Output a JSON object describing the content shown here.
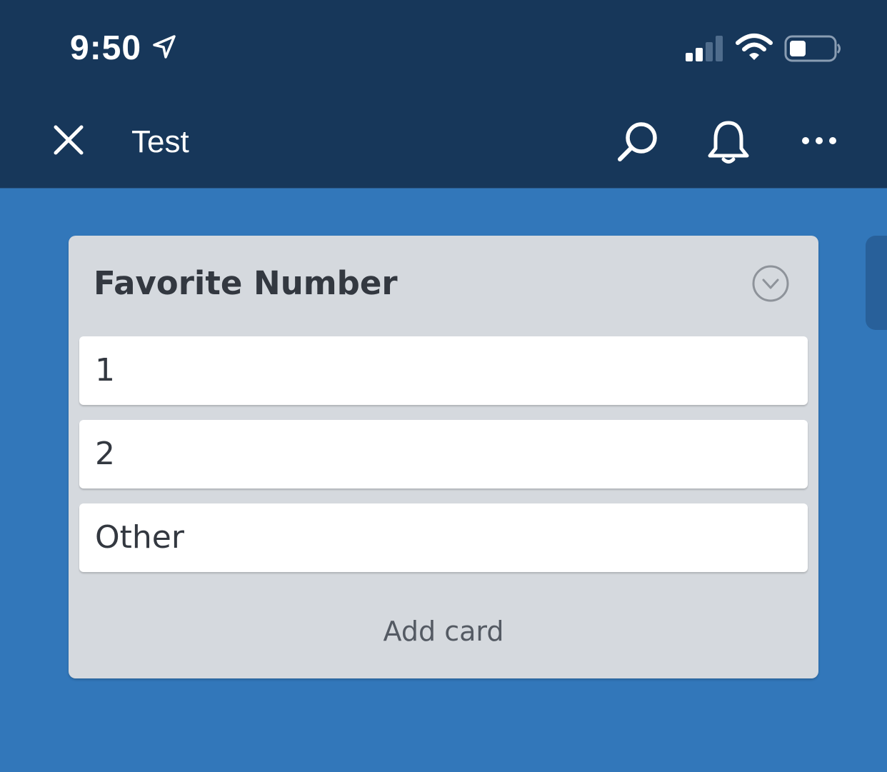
{
  "status_bar": {
    "time": "9:50",
    "icons": [
      "location-arrow-icon",
      "cellular-signal-icon",
      "wifi-icon",
      "battery-icon"
    ]
  },
  "header": {
    "title": "Test",
    "icons": [
      "close-icon",
      "search-icon",
      "bell-icon",
      "more-icon"
    ]
  },
  "list": {
    "title": "Favorite Number",
    "menu_icon": "chevron-down-circle-icon",
    "cards": [
      {
        "label": "1"
      },
      {
        "label": "2"
      },
      {
        "label": "Other"
      }
    ],
    "add_card_label": "Add card"
  },
  "colors": {
    "header_bg": "#17375A",
    "board_bg": "#3277BA",
    "list_bg": "#D5D9DE",
    "card_bg": "#FFFFFF",
    "text_dark": "#333840"
  }
}
